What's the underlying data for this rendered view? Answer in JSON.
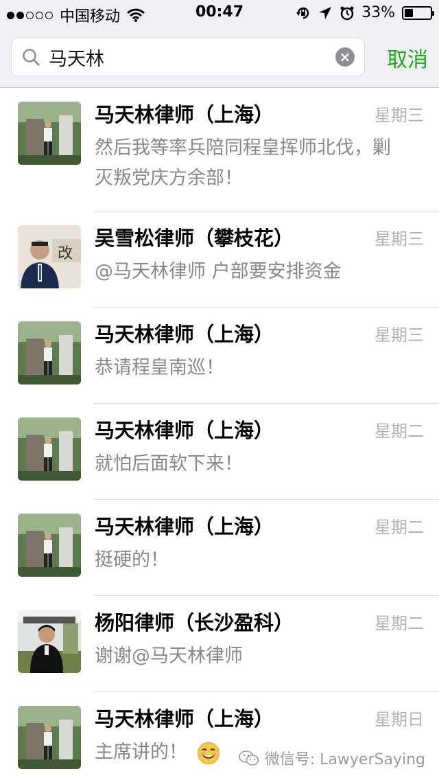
{
  "status_bar": {
    "carrier": "中国移动",
    "time": "00:47",
    "battery_percent": "33%",
    "battery_level": 0.33,
    "signal_bars_filled": 2,
    "signal_bars_total": 5
  },
  "search": {
    "query": "马天林",
    "cancel_label": "取消"
  },
  "results": [
    {
      "name": "马天林律师（上海）",
      "day": "星期三",
      "message": "然后我等率兵陪同程皇挥师北伐，剿灭叛党庆方余部！",
      "avatar": "portrait-icon-a"
    },
    {
      "name": "吴雪松律师（攀枝花）",
      "day": "星期三",
      "message": "@马天林律师 户部要安排资金",
      "avatar": "portrait-icon-b"
    },
    {
      "name": "马天林律师（上海）",
      "day": "星期三",
      "message": "恭请程皇南巡！",
      "avatar": "portrait-icon-a"
    },
    {
      "name": "马天林律师（上海）",
      "day": "星期二",
      "message": "就怕后面软下来！",
      "avatar": "portrait-icon-a"
    },
    {
      "name": "马天林律师（上海）",
      "day": "星期二",
      "message": "挺硬的！",
      "avatar": "portrait-icon-a"
    },
    {
      "name": "杨阳律师（长沙盈科）",
      "day": "星期二",
      "message": "谢谢@马天林律师",
      "avatar": "portrait-icon-c"
    },
    {
      "name": "马天林律师（上海）",
      "day": "星期日",
      "message": "主席讲的！",
      "avatar": "portrait-icon-a",
      "emoji": "smile-emoji-icon"
    }
  ],
  "watermark": {
    "text": "微信号: LawyerSaying"
  },
  "colors": {
    "accent_green": "#1aad19",
    "header_bg": "#efeff4",
    "secondary_text": "#888888",
    "day_text": "#b2b2b2"
  }
}
